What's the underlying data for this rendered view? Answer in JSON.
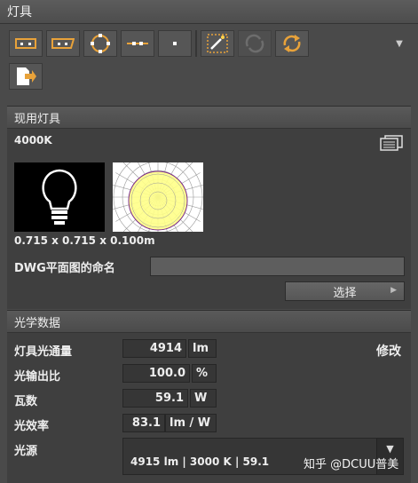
{
  "panel": {
    "title": "灯具"
  },
  "toolbar": {
    "row1": [
      {
        "icon": "rect-fixture-icon"
      },
      {
        "icon": "rect-outline-fixture-icon"
      },
      {
        "icon": "circle-fixture-icon"
      },
      {
        "icon": "line-fixture-icon"
      },
      {
        "icon": "point-fixture-icon"
      },
      {
        "icon": "magic-wand-icon"
      },
      {
        "icon": "rotate-disabled-icon"
      },
      {
        "icon": "rotate-icon"
      }
    ],
    "row2": [
      {
        "icon": "export-icon"
      }
    ]
  },
  "current": {
    "title": "现用灯具",
    "lamp_name": "4000K",
    "dimensions": "0.715 x 0.715 x 0.100m",
    "dwg_label": "DWG平面图的命名",
    "dwg_value": "",
    "select_label": "选择"
  },
  "optics": {
    "title": "光学数据",
    "modify_label": "修改",
    "rows": [
      {
        "label": "灯具光通量",
        "value": "4914",
        "unit": "lm"
      },
      {
        "label": "光输出比",
        "value": "100.0",
        "unit": "%"
      },
      {
        "label": "瓦数",
        "value": "59.1",
        "unit": "W"
      },
      {
        "label": "光效率",
        "value": "83.1",
        "unit": "lm / W"
      }
    ],
    "source_label": "光源",
    "source_value": "4915 lm  |  3000 K  |  59.1"
  },
  "watermark": "知乎 @DCUU普美",
  "colors": {
    "bulb_fill": "#ffff88",
    "grid": "#9a9a9a"
  }
}
